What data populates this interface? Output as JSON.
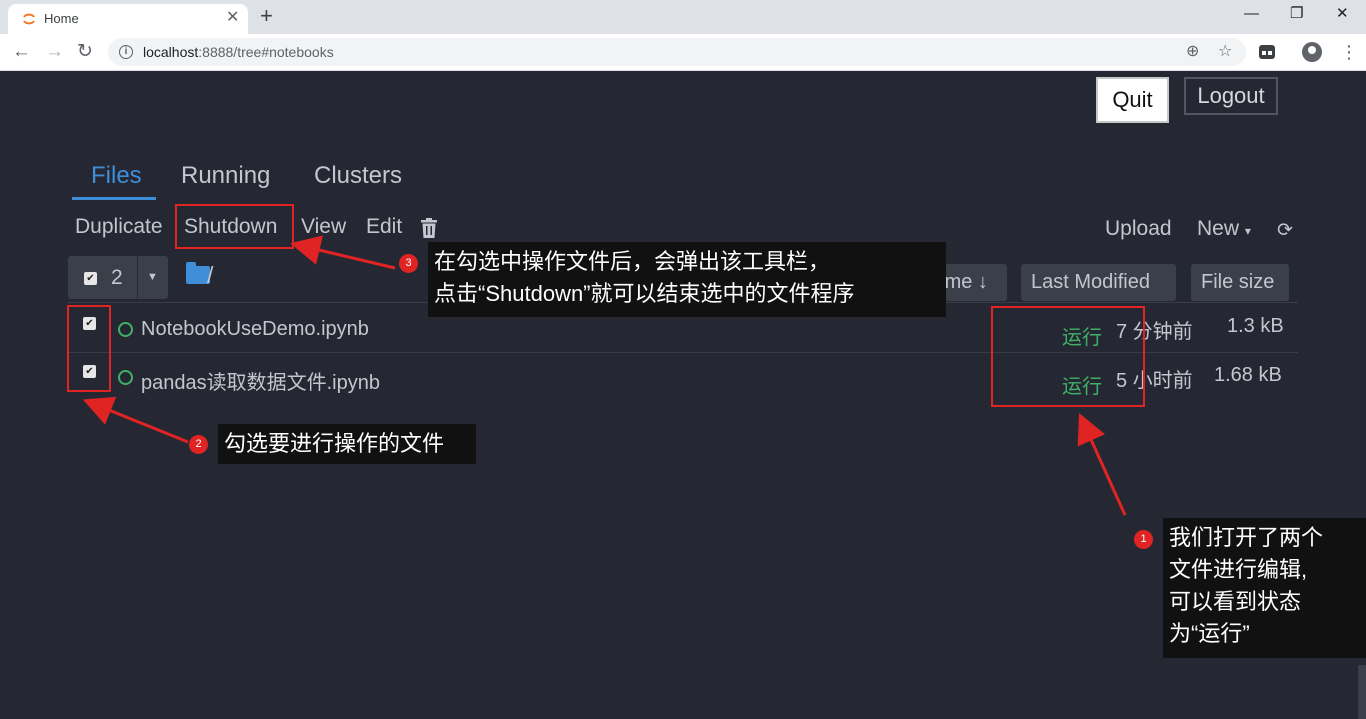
{
  "browser": {
    "tab_title": "Home",
    "tab_close": "✕",
    "new_tab": "+",
    "url_host": "localhost",
    "url_rest": ":8888/tree#notebooks",
    "info_glyph": "i",
    "win_min": "—",
    "win_max": "❐",
    "win_close": "✕",
    "nav_back": "←",
    "nav_forward": "→",
    "nav_reload": "↻",
    "zoom_glyph": "⊕",
    "star_glyph": "☆",
    "menu_glyph": "⋮"
  },
  "header": {
    "quit_label": "Quit",
    "logout_label": "Logout"
  },
  "tabs": [
    {
      "label": "Files",
      "active": true
    },
    {
      "label": "Running",
      "active": false
    },
    {
      "label": "Clusters",
      "active": false
    }
  ],
  "actions": {
    "duplicate": "Duplicate",
    "shutdown": "Shutdown",
    "view": "View",
    "edit": "Edit",
    "upload": "Upload",
    "new": "New",
    "new_caret": "▾",
    "refresh_glyph": "⟳"
  },
  "selection": {
    "count": "2",
    "check_glyph": "✔",
    "caret_glyph": "▼"
  },
  "path": {
    "slash": "/"
  },
  "columns": {
    "name": "Name ↓",
    "last_modified": "Last Modified",
    "file_size": "File size"
  },
  "files": [
    {
      "name": "NotebookUseDemo.ipynb",
      "status": "运行",
      "modified": "7 分钟前",
      "size": "1.3 kB"
    },
    {
      "name": "pandas读取数据文件.ipynb",
      "status": "运行",
      "modified": "5 小时前",
      "size": "1.68 kB"
    }
  ],
  "annotations": {
    "a1_num": "1",
    "a1_text": "我们打开了两个\n文件进行编辑,\n可以看到状态\n为“运行”",
    "a2_num": "2",
    "a2_text": "勾选要进行操作的文件",
    "a3_num": "3",
    "a3_text": "在勾选中操作文件后，会弹出该工具栏，\n点击“Shutdown”就可以结束选中的文件程序"
  },
  "colors": {
    "page_bg": "#252832",
    "accent": "#3f8ed9",
    "running": "#3fb167",
    "annotation": "#e02424"
  }
}
